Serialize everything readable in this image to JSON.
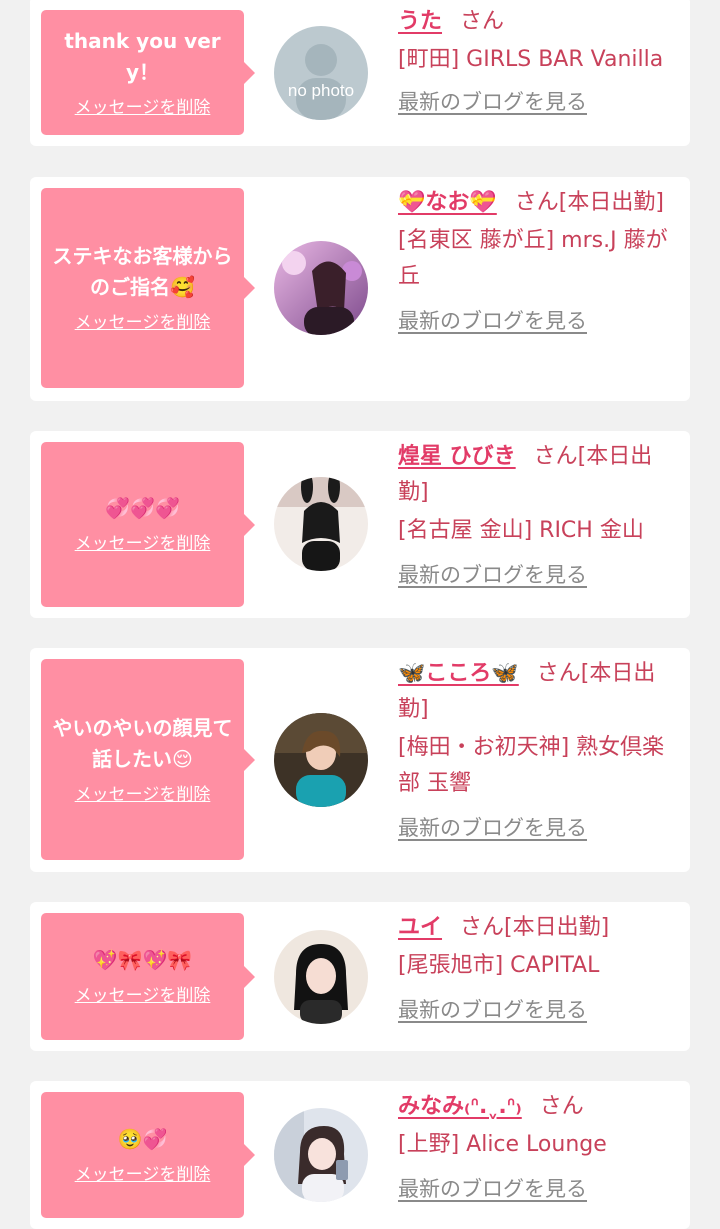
{
  "messages": [
    {
      "message": "thank you very！",
      "delete_label": "メッセージを削除",
      "name": "うた",
      "honorific": "さん",
      "shop": "[町田] GIRLS BAR Vanilla",
      "blog_link": "最新のブログを見る",
      "avatar_overlay": "no photo",
      "avatar_icon": "placeholder-avatar-icon"
    },
    {
      "message": "ステキなお客様からのご指名🥰",
      "delete_label": "メッセージを削除",
      "name": "💝なお💝",
      "honorific": "さん[本日出勤]",
      "shop": "[名東区 藤が丘] mrs.J 藤が丘",
      "blog_link": "最新のブログを見る"
    },
    {
      "message": "💞💞💞",
      "delete_label": "メッセージを削除",
      "name": "煌星 ひびき",
      "honorific": "さん[本日出勤]",
      "shop": "[名古屋 金山] RICH 金山",
      "blog_link": "最新のブログを見る"
    },
    {
      "message": "やいのやいの顔見て話したい😌",
      "delete_label": "メッセージを削除",
      "name": "🦋こころ🦋",
      "honorific": "さん[本日出勤]",
      "shop": "[梅田・お初天神] 熟女倶楽部 玉響",
      "blog_link": "最新のブログを見る"
    },
    {
      "message": "💖🎀💖🎀",
      "delete_label": "メッセージを削除",
      "name": "ユイ",
      "honorific": "さん[本日出勤]",
      "shop": "[尾張旭市] CAPITAL",
      "blog_link": "最新のブログを見る"
    },
    {
      "message": "🥹💞",
      "delete_label": "メッセージを削除",
      "name": "みなみ₍ᐢ.ˬ.ᐢ₎",
      "honorific": "さん",
      "shop": "[上野] Alice Lounge",
      "blog_link": "最新のブログを見る"
    }
  ],
  "colors": {
    "bubble": "#ff8fa3",
    "name": "#e23b67",
    "shop_text": "#c8415a",
    "link_gray": "#8a8a8a",
    "page_background": "#f1f1f1",
    "card_background": "#ffffff"
  }
}
